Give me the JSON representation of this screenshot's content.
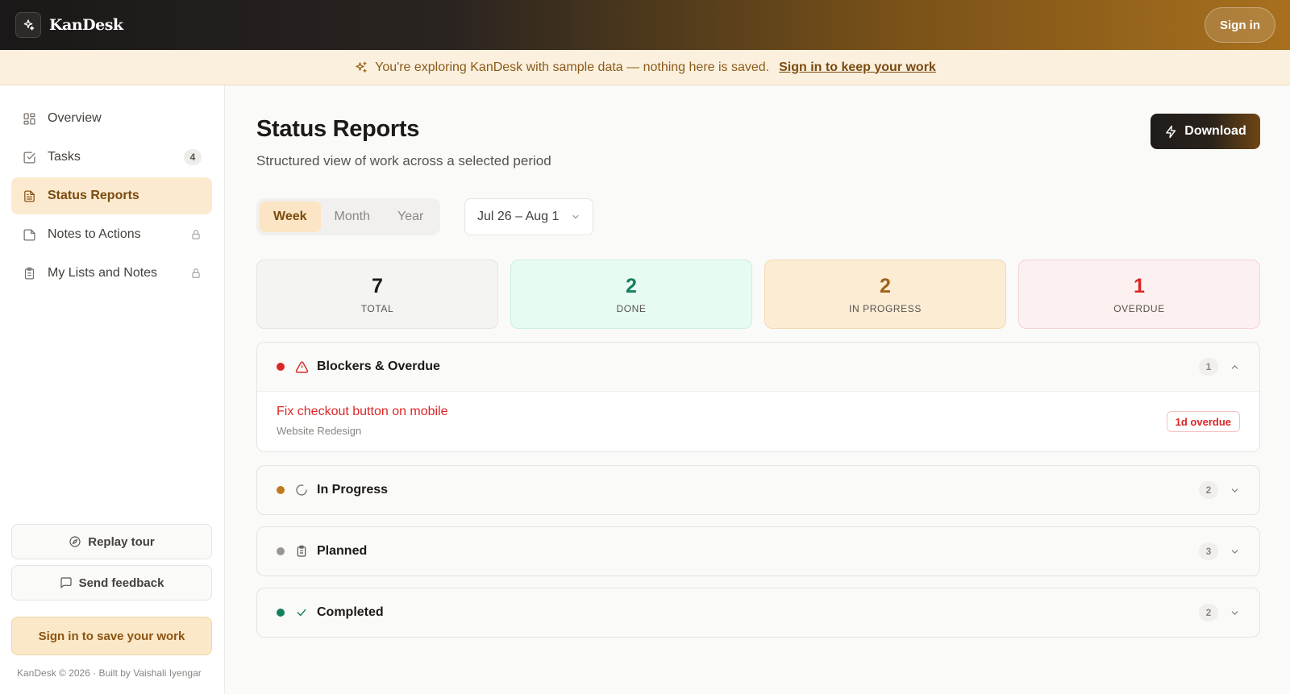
{
  "app": {
    "name": "KanDesk",
    "signin_label": "Sign in"
  },
  "banner": {
    "text": "You're exploring KanDesk with sample data — nothing here is saved.",
    "link": "Sign in to keep your work"
  },
  "sidebar": {
    "items": [
      {
        "label": "Overview",
        "icon": "grid-icon"
      },
      {
        "label": "Tasks",
        "icon": "checkbox-icon",
        "badge": "4"
      },
      {
        "label": "Status Reports",
        "icon": "document-icon",
        "active": true
      },
      {
        "label": "Notes to Actions",
        "icon": "note-icon",
        "locked": true
      },
      {
        "label": "My Lists and Notes",
        "icon": "clipboard-icon",
        "locked": true
      }
    ],
    "replay_tour": "Replay tour",
    "send_feedback": "Send feedback",
    "signin_save": "Sign in to save your work",
    "footer": "KanDesk © 2026 · Built by Vaishali Iyengar"
  },
  "main": {
    "title": "Status Reports",
    "subtitle": "Structured view of work across a selected period",
    "download_label": "Download",
    "periods": [
      "Week",
      "Month",
      "Year"
    ],
    "selected_period": "Week",
    "date_range": "Jul 26 – Aug 1",
    "stats": [
      {
        "value": "7",
        "label": "TOTAL",
        "color": "#1c1917",
        "bg": "#f4f4f3"
      },
      {
        "value": "2",
        "label": "DONE",
        "color": "#15805d",
        "bg": "#e7fbf3"
      },
      {
        "value": "2",
        "label": "IN PROGRESS",
        "color": "#a0621a",
        "bg": "#fcecd4"
      },
      {
        "value": "1",
        "label": "OVERDUE",
        "color": "#dc2626",
        "bg": "#fdf0f0"
      }
    ],
    "sections": [
      {
        "title": "Blockers & Overdue",
        "count": "1",
        "dot": "#dc2626",
        "icon": "warning-icon",
        "expanded": true,
        "tasks": [
          {
            "title": "Fix checkout button on mobile",
            "project": "Website Redesign",
            "badge": "1d overdue"
          }
        ]
      },
      {
        "title": "In Progress",
        "count": "2",
        "dot": "#c07a1c",
        "icon": "spinner-icon",
        "expanded": false
      },
      {
        "title": "Planned",
        "count": "3",
        "dot": "#9a9590",
        "icon": "clipboard-icon",
        "expanded": false
      },
      {
        "title": "Completed",
        "count": "2",
        "dot": "#15805d",
        "icon": "check-icon",
        "expanded": false
      }
    ]
  }
}
